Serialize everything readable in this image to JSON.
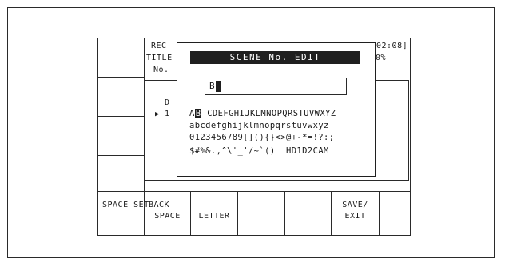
{
  "status": {
    "line1": "REC",
    "line2": "TITLE",
    "line3": "No.",
    "time": "02:08]",
    "percent": "0%"
  },
  "list": {
    "header": "D",
    "row_marker": "▶",
    "row_index": "1"
  },
  "dialog": {
    "title": "SCENE No. EDIT",
    "entry_value": "B",
    "charset_row1_head": "A",
    "charset_row1_cursor": "B",
    "charset_row1_rest": " CDEFGHIJKLMNOPQRSTUVWXYZ",
    "charset_row2": "abcdefghijklmnopqrstuvwxyz",
    "charset_row3": "0123456789[](){}<>@+-*=!?:;",
    "charset_row4": "$#%&.,^\\'_'/~`()  HD1D2CAM"
  },
  "softkeys": {
    "key1": "SPACE SET",
    "key2_line1": "BACK",
    "key2_line2": "SPACE",
    "key3": "LETTER",
    "key6_line1": "SAVE/",
    "key6_line2": "EXIT"
  }
}
